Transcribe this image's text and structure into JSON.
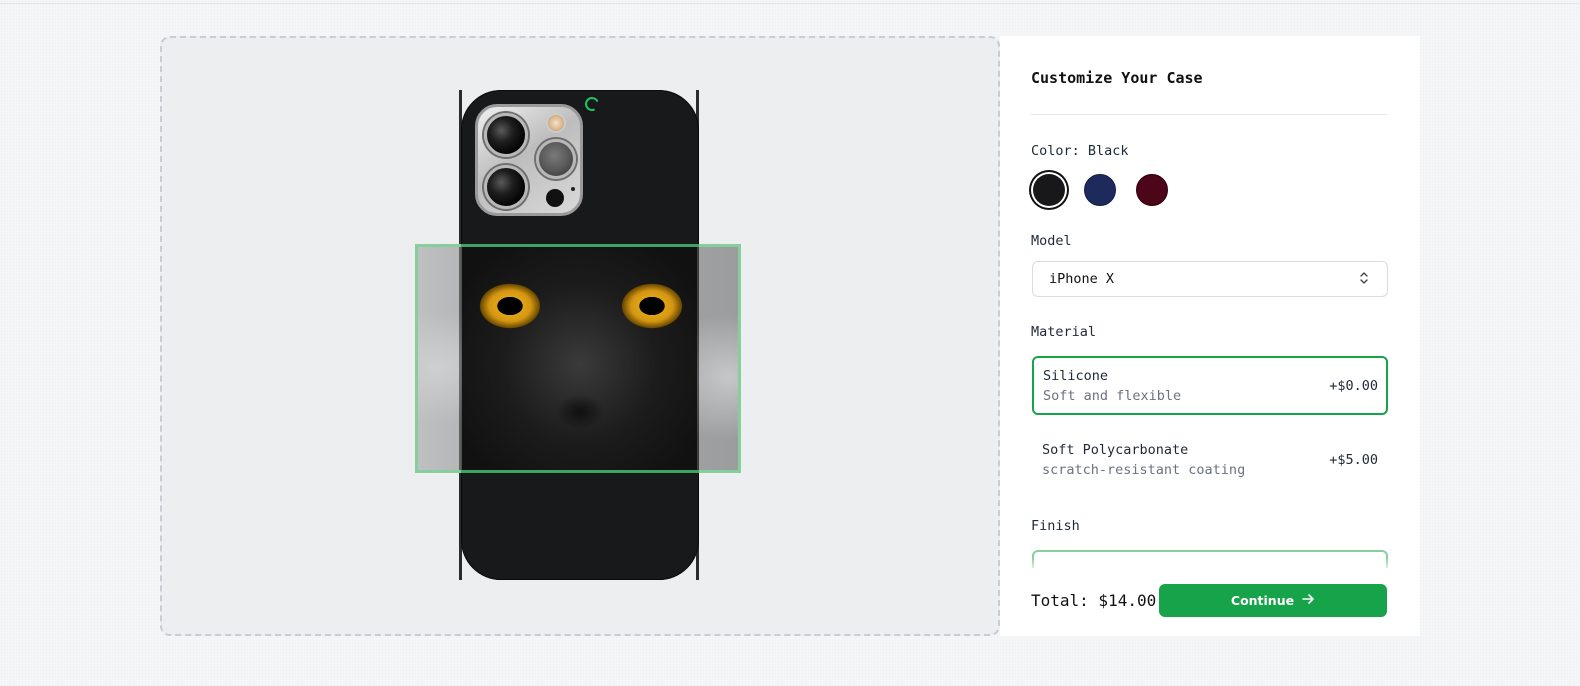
{
  "panel": {
    "title": "Customize Your Case",
    "color": {
      "label": "Color: Black",
      "options": [
        {
          "name": "Black",
          "hex": "#18181b",
          "selected": true
        },
        {
          "name": "Blue",
          "hex": "#1e2a5c",
          "selected": false
        },
        {
          "name": "Rose",
          "hex": "#4c0519",
          "selected": false
        }
      ]
    },
    "model": {
      "label": "Model",
      "selected": "iPhone X"
    },
    "material": {
      "label": "Material",
      "options": [
        {
          "name": "Silicone",
          "description": "Soft and flexible",
          "price": "+$0.00",
          "selected": true
        },
        {
          "name": "Soft Polycarbonate",
          "description": "scratch-resistant coating",
          "price": "+$5.00",
          "selected": false
        }
      ]
    },
    "finish": {
      "label": "Finish"
    },
    "total": "Total: $14.00",
    "continue_label": "Continue",
    "continue_icon": "arrow-right-icon"
  },
  "colors": {
    "accent": "#16a34a",
    "frame_border": "#86ce9c"
  },
  "preview": {
    "image_subject": "black-cat-photo",
    "loading_icon": "spinner-icon"
  }
}
